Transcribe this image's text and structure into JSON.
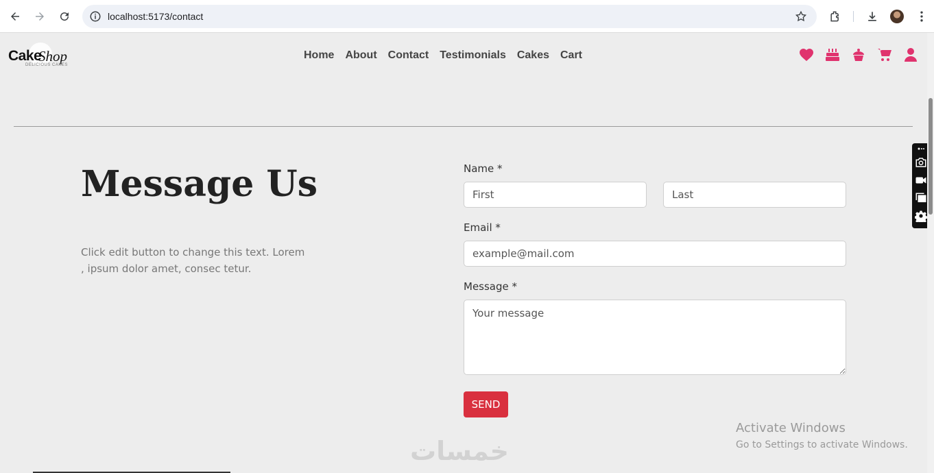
{
  "browser": {
    "url": "localhost:5173/contact"
  },
  "site": {
    "logo_main": "Cake",
    "logo_script": "Shop",
    "logo_tagline": "DELICIOUS CAKES",
    "menu": [
      "Home",
      "About",
      "Contact",
      "Testimonials",
      "Cakes",
      "Cart"
    ],
    "icons": [
      "heart-icon",
      "birthday-cake-icon",
      "cupcake-icon",
      "cart-icon",
      "user-icon"
    ],
    "accent_color": "#e0336e"
  },
  "contact": {
    "title": "Message Us",
    "description": "Click edit button to change this text. Lorem , ipsum dolor amet, consec tetur.",
    "name_label": "Name *",
    "first_placeholder": "First",
    "last_placeholder": "Last",
    "email_label": "Email *",
    "email_placeholder": "example@mail.com",
    "message_label": "Message *",
    "message_placeholder": "Your message",
    "send_label": "SEND",
    "send_color": "#d9303f"
  },
  "overlay": {
    "activate_title": "Activate Windows",
    "activate_sub": "Go to Settings to activate Windows.",
    "watermark_text": "خمسات"
  }
}
